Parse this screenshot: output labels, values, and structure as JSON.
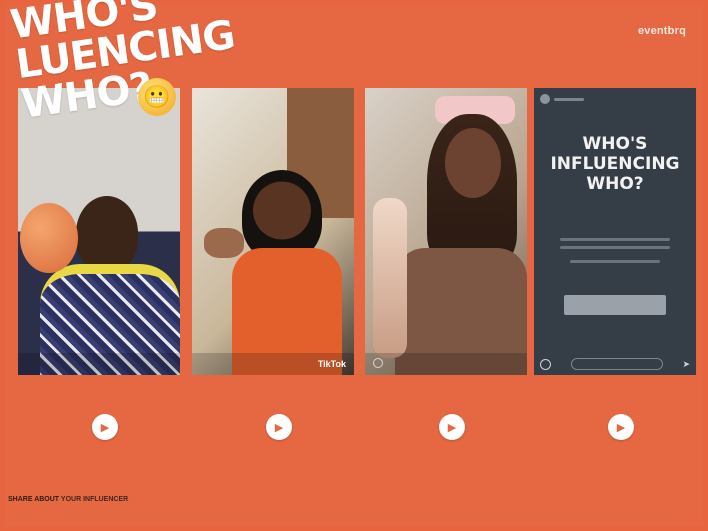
{
  "brand": "eventbrq",
  "headline": "WHO'S\nLUENCING\nWHO?",
  "emoji": "😬",
  "cards": [
    {
      "id": "c1",
      "caption": "",
      "button_label": "",
      "icon": "play-icon"
    },
    {
      "id": "c2",
      "caption": "",
      "button_label": "",
      "icon": "play-icon",
      "tiktok": "TikTok"
    },
    {
      "id": "c3",
      "caption": "",
      "button_label": "",
      "icon": "play-icon"
    },
    {
      "id": "c4",
      "caption": "",
      "button_label": "",
      "icon": "play-icon",
      "title": "WHO'S\nINFLUENCING\nWHO?"
    }
  ],
  "footer": {
    "left": "SHARE ABOUT",
    "right": "YOUR INFLUENCER"
  },
  "colors": {
    "background": "#e8643f",
    "card4": "#353d46",
    "button": "#ffffff"
  }
}
